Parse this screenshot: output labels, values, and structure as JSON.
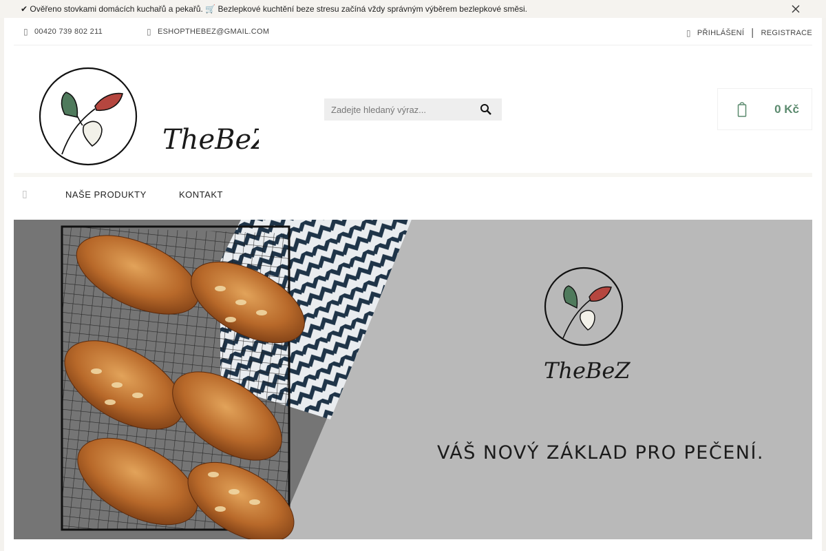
{
  "notice": {
    "text": "✔ Ověřeno stovkami domácích kuchařů a pekařů. 🛒 Bezlepkové kuchtění beze stresu začíná vždy správným výběrem bezlepkové směsi."
  },
  "topbar": {
    "phone": "00420 739 802 211",
    "email": "ESHOPTHEBEZ@GMAIL.COM",
    "login": "PŘIHLÁŠENÍ",
    "separator": "|",
    "register": "REGISTRACE"
  },
  "brand": {
    "name": "TheBeZ"
  },
  "search": {
    "placeholder": "Zadejte hledaný výraz..."
  },
  "cart": {
    "total": "0 Kč"
  },
  "nav": {
    "items": [
      {
        "label": "NAŠE PRODUKTY"
      },
      {
        "label": "KONTAKT"
      }
    ]
  },
  "banner": {
    "brand": "TheBeZ",
    "tagline": "VÁŠ NOVÝ ZÁKLAD PRO PEČENÍ."
  },
  "colors": {
    "accent": "#5b8a6e",
    "leaf_green": "#4f7a5c",
    "leaf_red": "#b5463f",
    "banner_gray": "#b9b9b9"
  },
  "icons": [
    "close-icon",
    "phone-icon",
    "mail-icon",
    "user-icon",
    "search-icon",
    "shopping-bag-icon",
    "home-icon"
  ]
}
